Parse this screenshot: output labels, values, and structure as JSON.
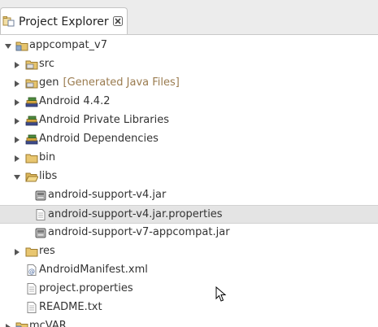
{
  "view": {
    "tab_title": "Project Explorer",
    "tab_icon": "project-explorer-icon",
    "close_icon": "close-icon"
  },
  "tree": {
    "items": [
      {
        "label": "appcompat_v7",
        "decoration": "",
        "icon": "project-folder-icon",
        "expanded": true
      },
      {
        "label": "src",
        "decoration": "",
        "icon": "source-folder-icon",
        "expanded": false
      },
      {
        "label": "gen",
        "decoration": "[Generated Java Files]",
        "icon": "generated-folder-icon",
        "expanded": false
      },
      {
        "label": "Android 4.4.2",
        "decoration": "",
        "icon": "library-icon",
        "expanded": false
      },
      {
        "label": "Android Private Libraries",
        "decoration": "",
        "icon": "library-icon",
        "expanded": false
      },
      {
        "label": "Android Dependencies",
        "decoration": "",
        "icon": "library-icon",
        "expanded": false
      },
      {
        "label": "bin",
        "decoration": "",
        "icon": "folder-icon",
        "expanded": false
      },
      {
        "label": "libs",
        "decoration": "",
        "icon": "folder-open-icon",
        "expanded": true
      },
      {
        "label": "android-support-v4.jar",
        "decoration": "",
        "icon": "jar-icon"
      },
      {
        "label": "android-support-v4.jar.properties",
        "decoration": "",
        "icon": "text-file-icon",
        "selected": true
      },
      {
        "label": "android-support-v7-appcompat.jar",
        "decoration": "",
        "icon": "jar-icon"
      },
      {
        "label": "res",
        "decoration": "",
        "icon": "folder-icon",
        "expanded": false
      },
      {
        "label": "AndroidManifest.xml",
        "decoration": "",
        "icon": "xml-file-icon"
      },
      {
        "label": "project.properties",
        "decoration": "",
        "icon": "text-file-icon"
      },
      {
        "label": "README.txt",
        "decoration": "",
        "icon": "text-file-icon"
      },
      {
        "label": "mcVAR",
        "decoration": "",
        "icon": "project-folder-icon",
        "expanded": false
      }
    ]
  },
  "colors": {
    "selection": "#e4e4e4",
    "decoration": "#9a7b4f",
    "folder": "#d9b45a"
  }
}
